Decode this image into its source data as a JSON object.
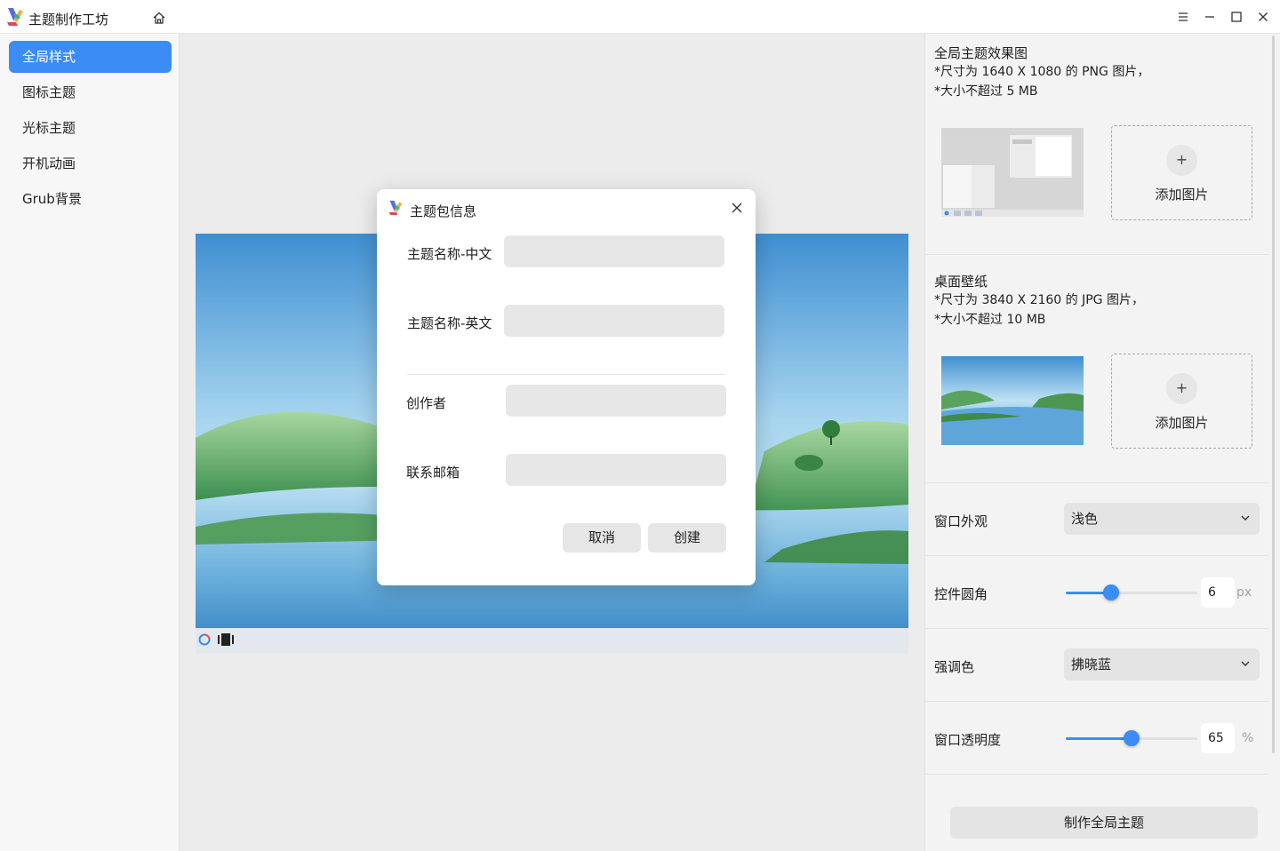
{
  "app": {
    "title": "主题制作工坊"
  },
  "sidebar": {
    "items": [
      {
        "label": "全局样式",
        "active": true
      },
      {
        "label": "图标主题"
      },
      {
        "label": "光标主题"
      },
      {
        "label": "开机动画"
      },
      {
        "label": "Grub背景"
      }
    ]
  },
  "dialog": {
    "title": "主题包信息",
    "fields": {
      "name_cn": {
        "label": "主题名称-中文",
        "value": ""
      },
      "name_en": {
        "label": "主题名称-英文",
        "value": ""
      },
      "author": {
        "label": "创作者",
        "value": ""
      },
      "email": {
        "label": "联系邮箱",
        "value": ""
      }
    },
    "cancel_label": "取消",
    "create_label": "创建"
  },
  "right": {
    "preview_section": {
      "title": "全局主题效果图",
      "desc1": "*尺寸为 1640 X 1080 的 PNG 图片，",
      "desc2": "*大小不超过 5 MB",
      "add_label": "添加图片",
      "add_icon": "+"
    },
    "wallpaper_section": {
      "title": "桌面壁纸",
      "desc1": "*尺寸为 3840 X 2160 的 JPG 图片，",
      "desc2": "*大小不超过 10 MB",
      "add_label": "添加图片",
      "add_icon": "+"
    },
    "appearance": {
      "label": "窗口外观",
      "value": "浅色"
    },
    "radius": {
      "label": "控件圆角",
      "value": "6",
      "unit": "px",
      "fraction": 0.32
    },
    "accent": {
      "label": "强调色",
      "value": "拂晓蓝"
    },
    "opacity": {
      "label": "窗口透明度",
      "value": "65",
      "unit": "%",
      "fraction": 0.5
    },
    "make_button": "制作全局主题"
  },
  "colors": {
    "accent": "#3b8cf5"
  }
}
